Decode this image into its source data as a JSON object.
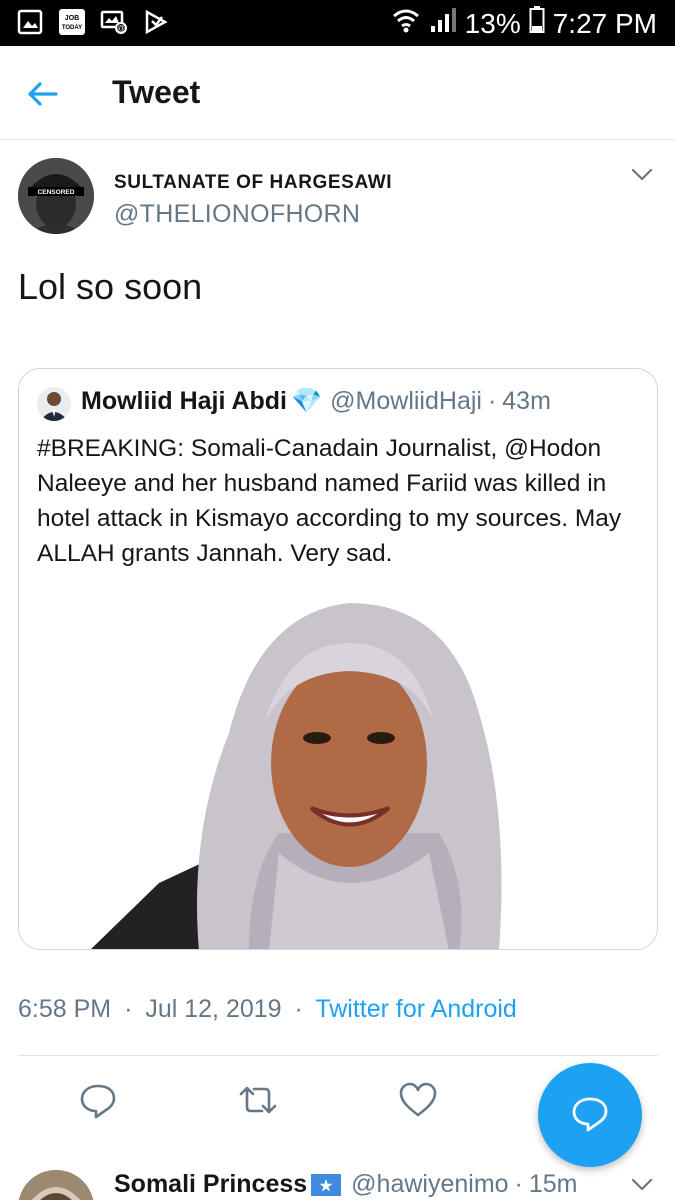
{
  "status_bar": {
    "battery": "13%",
    "time": "7:27 PM",
    "icons_left": [
      "gallery-icon",
      "job-today-icon",
      "screen-mail-icon",
      "play-store-icon"
    ],
    "icons_right": [
      "wifi-icon",
      "signal-icon",
      "battery-icon"
    ],
    "app_badge_text": "JOB TODAY"
  },
  "header": {
    "title": "Tweet"
  },
  "tweet": {
    "author_name": "SULTANATE OF HARGESAWI",
    "author_handle": "@THELIONOFHORN",
    "avatar_label": "CENSORED",
    "text": "Lol so soon",
    "timestamp": "6:58 PM",
    "date": "Jul 12, 2019",
    "source": "Twitter for Android",
    "separator": "·"
  },
  "quoted_tweet": {
    "author_name": "Mowliid Haji Abdi",
    "verified_emoji": "💎",
    "handle": "@MowliidHaji",
    "separator": "·",
    "time_ago": "43m",
    "text": "#BREAKING: Somali-Canadain Journalist, @Hodon Naleeye and her husband named Fariid was killed in hotel attack in Kismayo according to my sources. May ALLAH grants Jannah. Very sad."
  },
  "actions": {
    "icons": [
      "reply-icon",
      "retweet-icon",
      "like-icon",
      "compose-reply-icon"
    ]
  },
  "next_reply": {
    "author_name": "Somali Princess",
    "handle": "@hawiyenimo",
    "separator": "·",
    "time_ago": "15m"
  },
  "colors": {
    "accent": "#1da1f2",
    "secondary_text": "#657786",
    "border": "#ccd6dd",
    "text": "#14171a"
  }
}
